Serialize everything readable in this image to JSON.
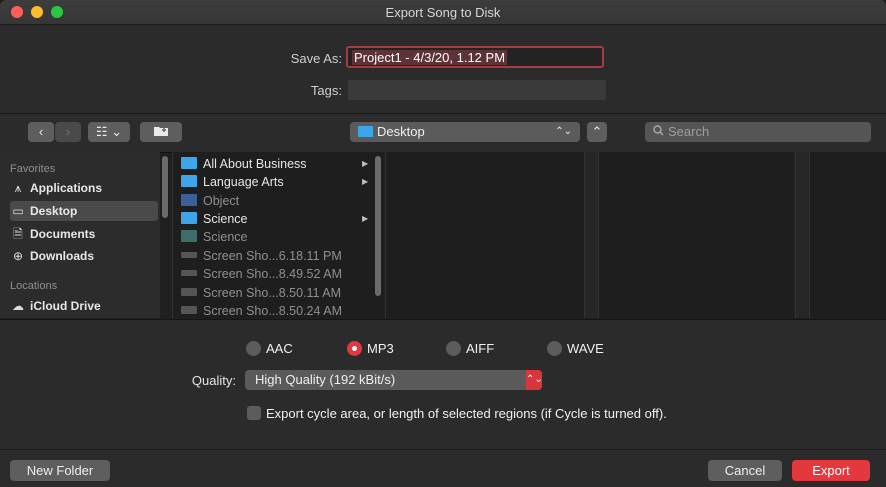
{
  "window": {
    "title": "Export Song to Disk"
  },
  "form": {
    "save_as_label": "Save As:",
    "save_as_value": "Project1 - 4/3/20, 1.12 PM",
    "tags_label": "Tags:",
    "tags_value": ""
  },
  "toolbar": {
    "back_glyph": "‹",
    "forward_glyph": "›",
    "view_glyph": "☷ ⌄",
    "location": "Desktop",
    "location_caret": "⌃⌄",
    "expand_glyph": "⌃",
    "search_placeholder": "Search"
  },
  "sidebar": {
    "sections": [
      {
        "title": "Favorites",
        "items": [
          {
            "label": "Applications",
            "icon": "applications-icon",
            "glyph": "⩚"
          },
          {
            "label": "Desktop",
            "icon": "desktop-icon",
            "glyph": "▭",
            "selected": true
          },
          {
            "label": "Documents",
            "icon": "documents-icon",
            "glyph": "🗎"
          },
          {
            "label": "Downloads",
            "icon": "downloads-icon",
            "glyph": "⊕"
          }
        ]
      },
      {
        "title": "Locations",
        "items": [
          {
            "label": "iCloud Drive",
            "icon": "cloud-icon",
            "glyph": "☁"
          }
        ]
      }
    ]
  },
  "files": [
    {
      "name": "All About Business",
      "type": "folder",
      "enabled": true,
      "has_children": true
    },
    {
      "name": "Language Arts",
      "type": "folder",
      "enabled": true,
      "has_children": true
    },
    {
      "name": "Object",
      "type": "document",
      "enabled": false,
      "has_children": false
    },
    {
      "name": "Science",
      "type": "folder",
      "enabled": true,
      "has_children": true
    },
    {
      "name": "Science",
      "type": "file",
      "enabled": false,
      "has_children": false
    },
    {
      "name": "Screen Sho...6.18.11 PM",
      "type": "image",
      "enabled": false,
      "has_children": false
    },
    {
      "name": "Screen Sho...8.49.52 AM",
      "type": "image",
      "enabled": false,
      "has_children": false
    },
    {
      "name": "Screen Sho...8.50.11 AM",
      "type": "image",
      "enabled": false,
      "has_children": false
    },
    {
      "name": "Screen Sho...8.50.24 AM",
      "type": "image",
      "enabled": false,
      "has_children": false
    }
  ],
  "export": {
    "formats": [
      {
        "label": "AAC",
        "selected": false
      },
      {
        "label": "MP3",
        "selected": true
      },
      {
        "label": "AIFF",
        "selected": false
      },
      {
        "label": "WAVE",
        "selected": false
      }
    ],
    "quality_label": "Quality:",
    "quality_value": "High Quality (192 kBit/s)",
    "quality_caret": "⌃⌄",
    "cycle_checkbox_label": "Export cycle area, or length of selected regions (if Cycle is turned off).",
    "cycle_checked": false
  },
  "footer": {
    "new_folder": "New Folder",
    "cancel": "Cancel",
    "export": "Export"
  },
  "colors": {
    "accent": "#e5373e",
    "folder": "#3ea6e8",
    "window_bg": "#2b2b2b"
  }
}
